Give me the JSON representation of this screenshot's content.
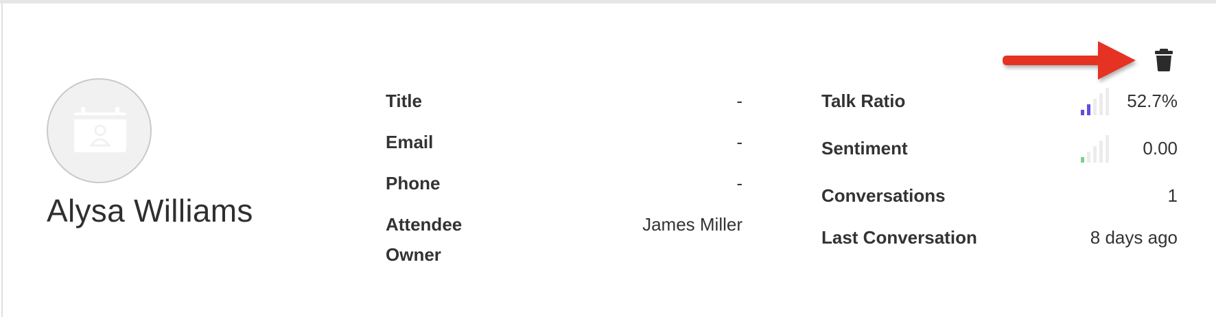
{
  "contact": {
    "name": "Alysa Williams"
  },
  "details": [
    {
      "label": "Title",
      "value": "-"
    },
    {
      "label": "Email",
      "value": "-"
    },
    {
      "label": "Phone",
      "value": "-"
    },
    {
      "label": "Attendee Owner",
      "value": "James Miller"
    }
  ],
  "stats": {
    "talk_ratio": {
      "label": "Talk Ratio",
      "value": "52.7%",
      "level_bars": 2,
      "bar_color": "#5b4fe0"
    },
    "sentiment": {
      "label": "Sentiment",
      "value": "0.00",
      "level_bars": 1,
      "bar_color": "#7ccf8a"
    },
    "conversations": {
      "label": "Conversations",
      "value": "1"
    },
    "last_conversation": {
      "label": "Last Conversation",
      "value": "8 days ago"
    }
  },
  "icons": {
    "avatar": "contact-card-icon",
    "delete": "trash-icon",
    "annotation": "red-arrow"
  },
  "colors": {
    "annotation_arrow": "#e53322",
    "icon_dark": "#2b2b2b"
  }
}
